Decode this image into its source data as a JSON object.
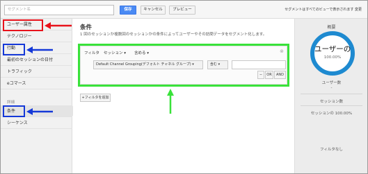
{
  "topbar": {
    "segment_name_placeholder": "セグメント名",
    "save_label": "保存",
    "cancel_label": "キャンセル",
    "preview_label": "プレビュー",
    "visibility_note": "セグメントはすべてのビューで表示されます 変更"
  },
  "sidebar": {
    "items": [
      {
        "label": "ユーザー属性"
      },
      {
        "label": "テクノロジー"
      },
      {
        "label": "行動"
      },
      {
        "label": "最初のセッションの日付"
      },
      {
        "label": "トラフィック"
      },
      {
        "label": "eコマース"
      }
    ],
    "advanced_heading": "詳細",
    "advanced_items": [
      {
        "label": "条件"
      },
      {
        "label": "シーケンス"
      }
    ]
  },
  "main": {
    "title": "条件",
    "description": "1 回のセッションか複数回のセッションかの条件によってユーザーやその訪問データをセグメント化します。",
    "filter": {
      "filter_label": "フィルタ",
      "scope_label": "セッション",
      "include_label": "含める",
      "dimension_value": "Default Channel Grouping(デフォルト チャネル グループ)",
      "operator_value": "含む",
      "condition_value": "",
      "minus_label": "−",
      "or_label": "OR",
      "and_label": "AND"
    },
    "add_filter_label": "+フィルタを追加"
  },
  "summary": {
    "title": "概要",
    "big_label": "ユーザーの",
    "percentage": "100.00%",
    "users_label": "ユーザー数",
    "users_value": "-",
    "sessions_label": "セッション数",
    "sessions_pct_label": "セッションの 100.00%",
    "no_filter_label": "フィルタなし"
  },
  "colors": {
    "annotation_red": "#e8121b",
    "annotation_blue": "#1438d8",
    "annotation_green": "#39e23a",
    "save_button": "#4a8af4",
    "donut": "#1e8ad0"
  }
}
